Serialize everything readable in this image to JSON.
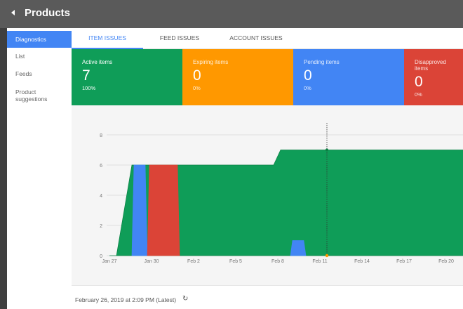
{
  "header": {
    "title": "Products"
  },
  "sidebar": {
    "items": [
      {
        "label": "Diagnostics"
      },
      {
        "label": "List"
      },
      {
        "label": "Feeds"
      },
      {
        "label_line1": "Product",
        "label_line2": "suggestions"
      }
    ]
  },
  "tabs": [
    {
      "label": "ITEM ISSUES"
    },
    {
      "label": "FEED ISSUES"
    },
    {
      "label": "ACCOUNT ISSUES"
    }
  ],
  "cards": [
    {
      "label": "Active items",
      "value": "7",
      "pct": "100%",
      "color": "#0f9d58"
    },
    {
      "label": "Expiring items",
      "value": "0",
      "pct": "0%",
      "color": "#ff9800"
    },
    {
      "label": "Pending items",
      "value": "0",
      "pct": "0%",
      "color": "#4285f4"
    },
    {
      "label": "Disapproved items",
      "value": "0",
      "pct": "0%",
      "color": "#db4437"
    }
  ],
  "chart_data": {
    "type": "area",
    "x_labels": [
      "Jan 27",
      "Jan 30",
      "Feb 2",
      "Feb 5",
      "Feb 8",
      "Feb 11",
      "Feb 14",
      "Feb 17",
      "Feb 20"
    ],
    "y_ticks": [
      "0",
      "2",
      "4",
      "6",
      "8"
    ],
    "ylim": [
      0,
      8
    ],
    "grid": true,
    "series": [
      {
        "color": "#0f9d58",
        "points": [
          [
            0,
            0
          ],
          [
            0.5,
            0
          ],
          [
            1.6,
            6
          ],
          [
            4.1,
            6
          ],
          [
            4.1,
            6
          ],
          [
            11.7,
            6
          ],
          [
            12.2,
            7
          ],
          [
            13,
            7
          ],
          [
            29,
            7
          ]
        ]
      },
      {
        "color": "#4285f4",
        "points": [
          [
            1.6,
            6
          ],
          [
            2.7,
            6
          ]
        ]
      },
      {
        "color": "#db4437",
        "points": [
          [
            2.7,
            6
          ],
          [
            5.0,
            6
          ]
        ]
      },
      {
        "color": "#4285f4",
        "points": [
          [
            12.9,
            1
          ],
          [
            14.0,
            1
          ]
        ]
      }
    ]
  },
  "footer": {
    "timestamp": "February 26, 2019 at 2:09 PM (Latest)"
  },
  "colors": {
    "accent": "#4285f4",
    "active": "#0f9d58",
    "expiring": "#ff9800",
    "disapproved": "#db4437"
  }
}
